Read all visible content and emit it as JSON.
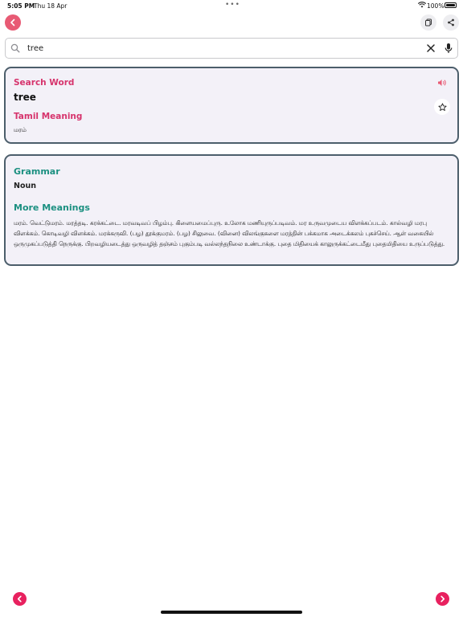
{
  "status_bar": {
    "time": "5:05 PM",
    "date": "Thu 18 Apr",
    "battery": "100%"
  },
  "search": {
    "value": "tree",
    "placeholder": ""
  },
  "search_card": {
    "search_word_label": "Search Word",
    "word": "tree",
    "tamil_meaning_label": "Tamil Meaning",
    "tamil_meaning": "மரம்"
  },
  "grammar_card": {
    "grammar_label": "Grammar",
    "grammar_value": "Noun",
    "more_meanings_label": "More Meanings",
    "more_meanings": "மரம். வெட்டுமரம். மரத்தடி. கரக்கட்டை. மரவடிவப் பிழம்பு. கிளையமைப்புரு. உலோக மணியுருப்படிவம். மர உருவமுடைய விளக்கப்படம். கால்வழி மரபு விளக்கம். கொடிவழி விளக்கம். மரக்கருவி. (பழ) தூக்குமரம். (பழ) சிலுவை. (வினை) விலங்குகளை மரத்தின் பக்கமாக அடைக்கலம் புகச்செய். ஆள் வகையில் ஒருமுகப்படுத்தி நெருக்கு. பிறவழியடைத்து ஒருவழித் தஞ்சம் புகும்படி வல்லந்தநிலை உண்டாக்கு. புதை மிதியைக் காலுருக்கட்டைமீது புதைமிதியை உருப்படுத்து."
  },
  "colors": {
    "accent_pink": "#d6336c",
    "accent_teal": "#1c9081",
    "card_border": "#4c5e6b",
    "card_bg": "#f3f1f8",
    "nav_button": "#e8215f"
  },
  "icons": {
    "back": "chevron-left-icon",
    "copy": "copy-icon",
    "share": "share-icon",
    "search": "search-icon",
    "clear": "close-icon",
    "mic": "microphone-icon",
    "speaker": "speaker-icon",
    "star": "star-icon",
    "prev": "chevron-left-icon",
    "next": "chevron-right-icon"
  }
}
